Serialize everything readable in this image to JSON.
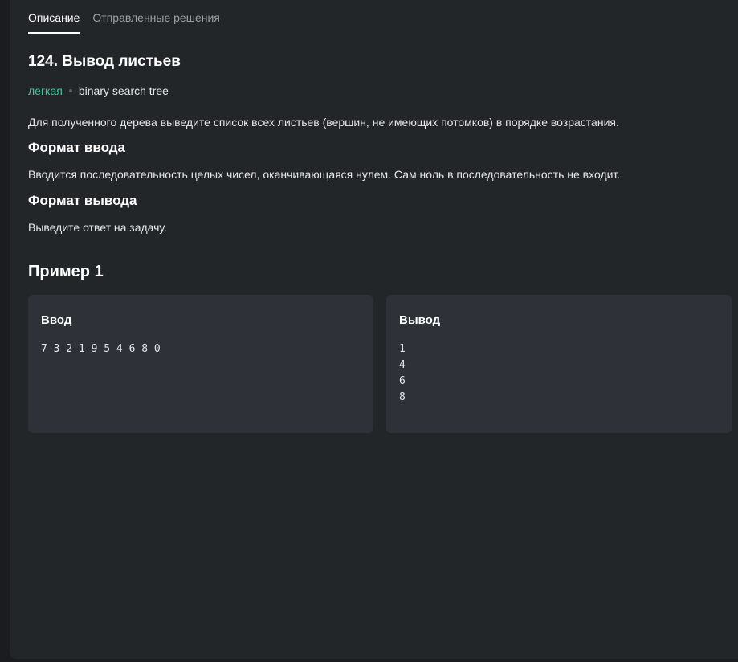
{
  "tabs": [
    {
      "label": "Описание",
      "active": true
    },
    {
      "label": "Отправленные решения",
      "active": false
    }
  ],
  "problem": {
    "title": "124. Вывод листьев",
    "difficulty": "легкая",
    "tag": "binary search tree",
    "statement": "Для полученного дерева выведите список всех листьев (вершин, не имеющих потомков) в порядке возрастания.",
    "input_heading": "Формат ввода",
    "input_text": "Вводится последовательность целых чисел, оканчивающаяся нулем. Сам ноль в последовательность не входит.",
    "output_heading": "Формат вывода",
    "output_text": "Выведите ответ на задачу."
  },
  "example": {
    "heading": "Пример 1",
    "input_label": "Ввод",
    "input_value": "7 3 2 1 9 5 4 6 8 0",
    "output_label": "Вывод",
    "output_value": "1\n4\n6\n8"
  },
  "colors": {
    "difficulty": "#3cc79c",
    "background": "#232629",
    "box": "#2e3138"
  }
}
